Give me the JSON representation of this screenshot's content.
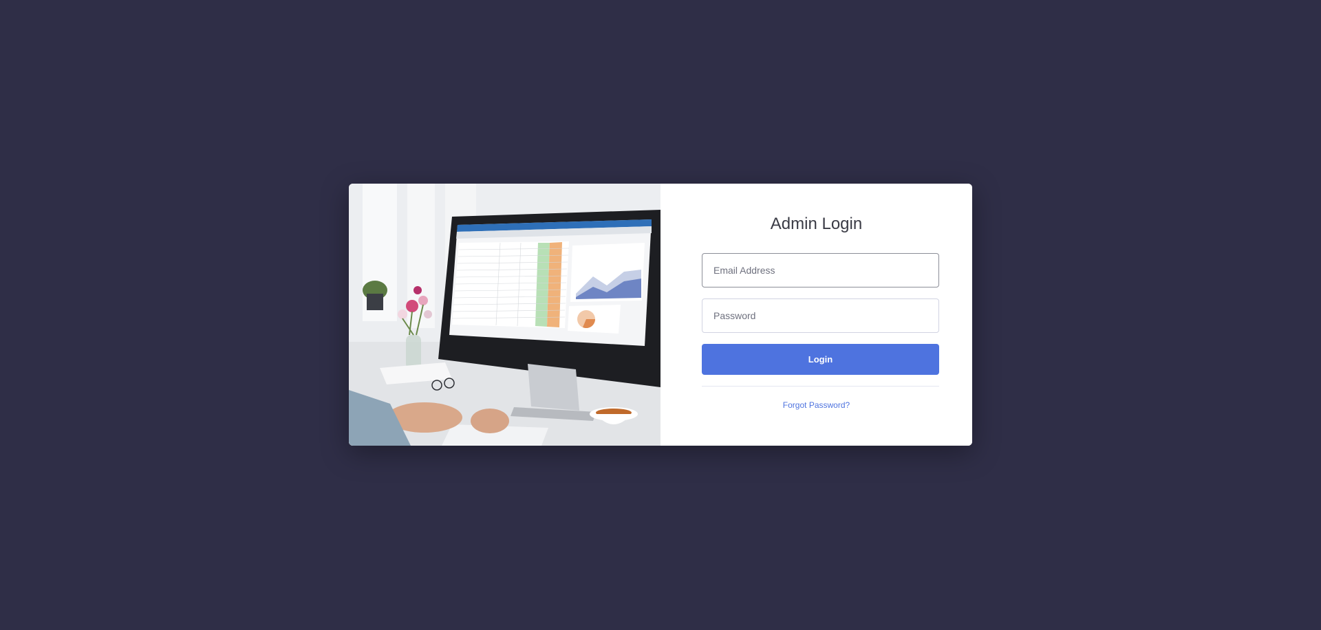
{
  "login_form": {
    "title": "Admin Login",
    "email_placeholder": "Email Address",
    "password_placeholder": "Password",
    "login_label": "Login",
    "forgot_password_label": "Forgot Password?"
  },
  "illustration": {
    "subject": "office desk with monitor showing spreadsheet and charts"
  },
  "colors": {
    "page_background": "#2f2e47",
    "card_background": "#ffffff",
    "accent": "#4e73df"
  }
}
